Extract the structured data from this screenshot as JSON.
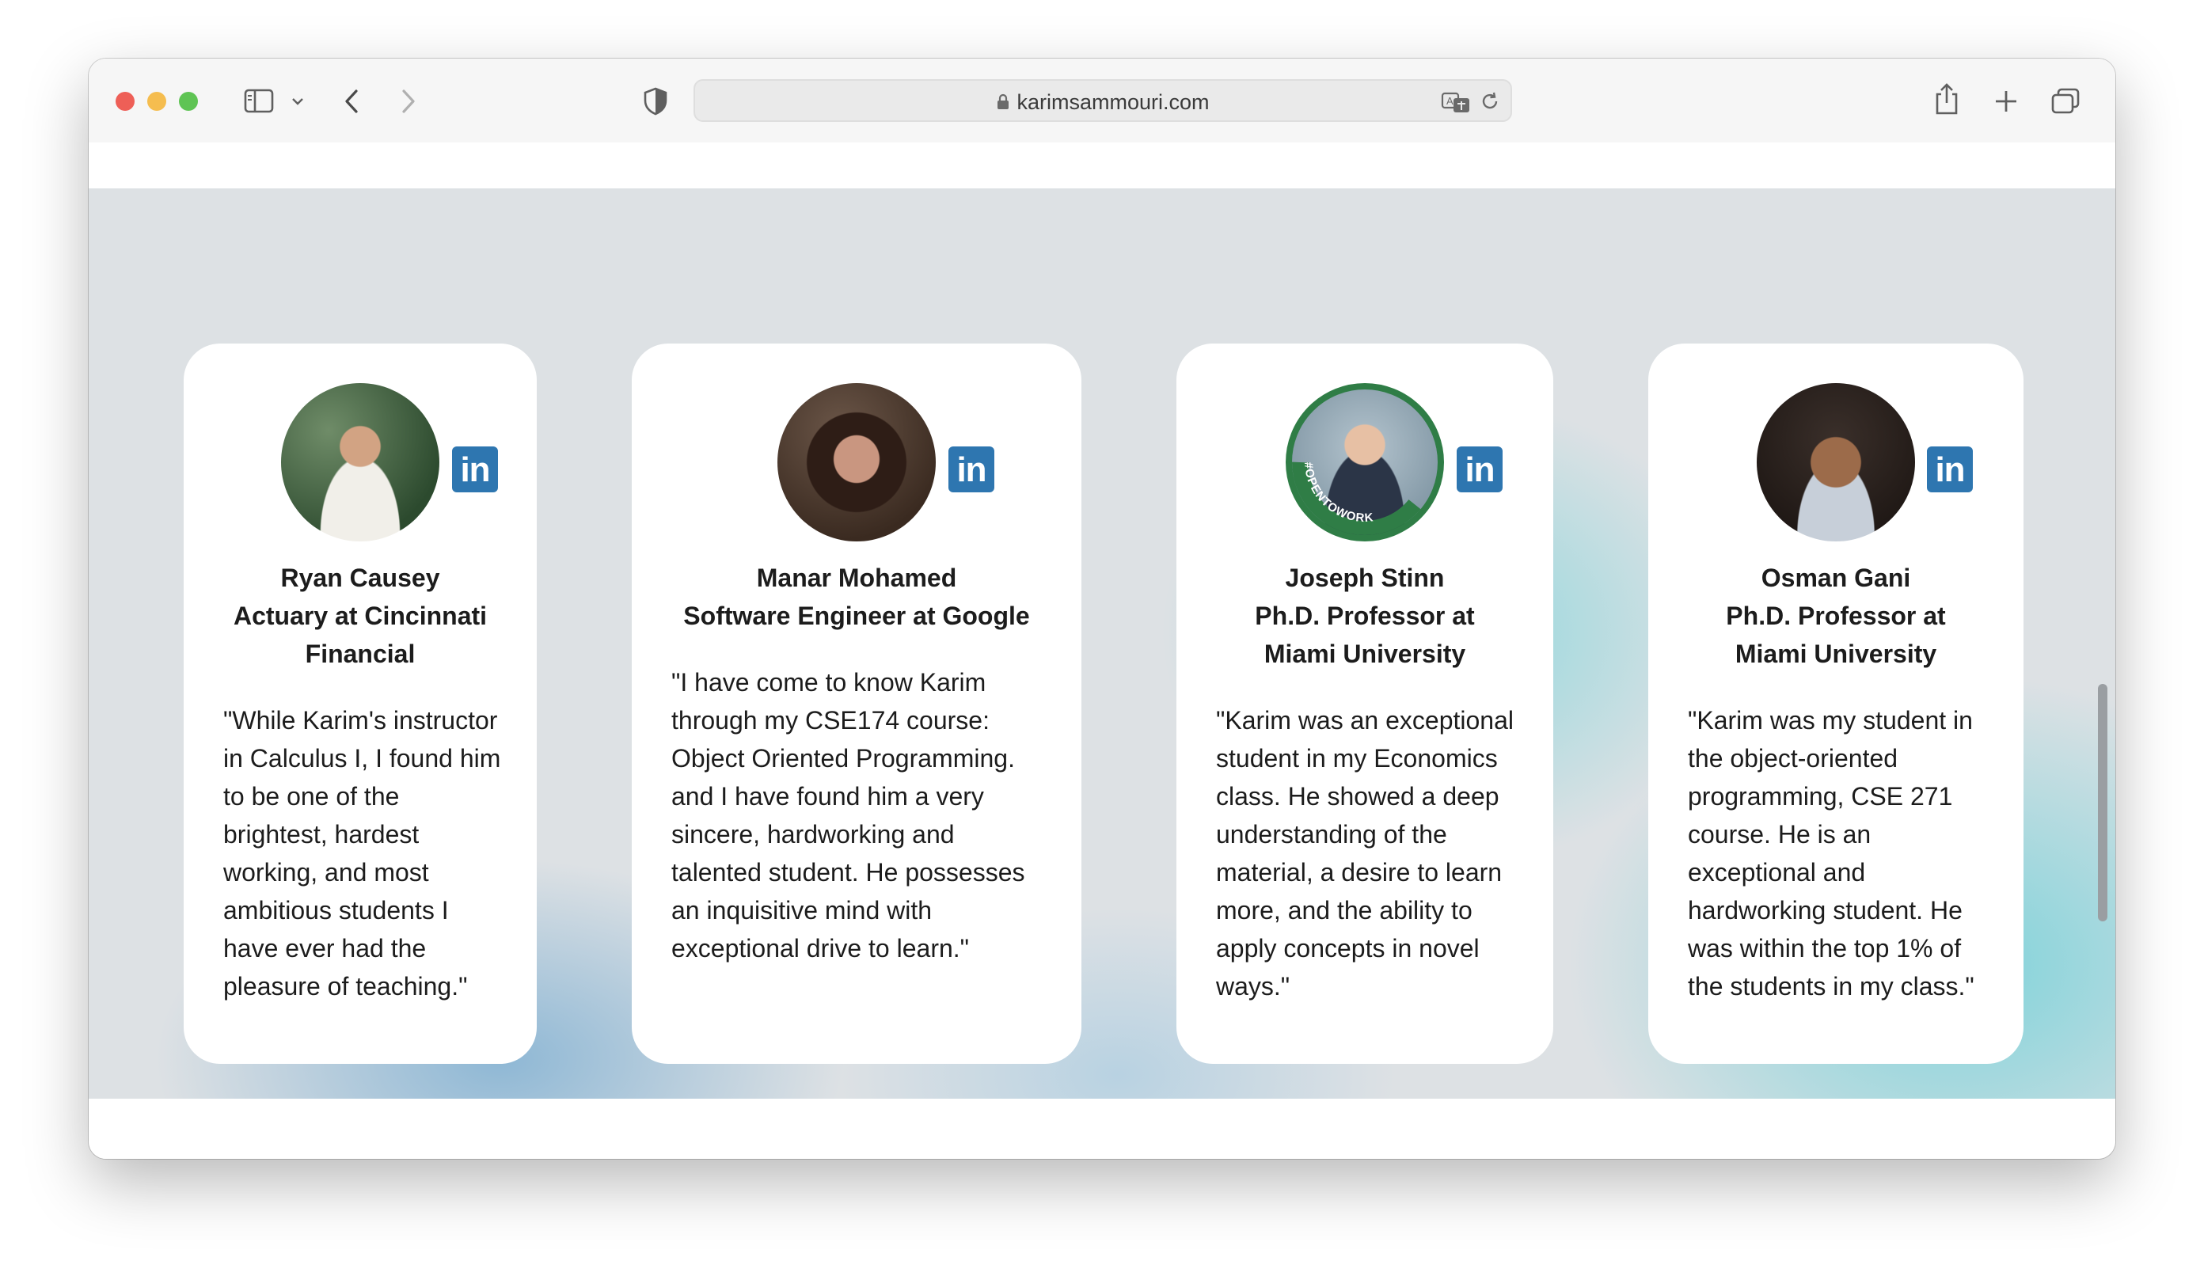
{
  "browser": {
    "url": "karimsammouri.com"
  },
  "testimonials": [
    {
      "name": "Ryan Causey",
      "title": "Actuary at Cincinnati Financial",
      "quote": "\"While Karim's instructor in Calculus I, I found him to be one of the brightest, hardest working, and most ambitious students I have ever had the pleasure of teaching.\"",
      "badge": ""
    },
    {
      "name": "Manar Mohamed",
      "title": "Software Engineer at Google",
      "quote": "\"I have come to know Karim through my CSE174 course: Object Oriented Programming. and I have found him a very sincere, hardworking and talented student. He possesses an inquisitive mind with exceptional drive to learn.\"",
      "badge": ""
    },
    {
      "name": "Joseph Stinn",
      "title": "Ph.D. Professor at Miami University",
      "quote": "\"Karim was an exceptional student in my Economics class. He showed a deep understanding of the material, a desire to learn more, and the ability to apply concepts in novel ways.\"",
      "badge": "#OPENTOWORK"
    },
    {
      "name": "Osman Gani",
      "title": "Ph.D. Professor at Miami University",
      "quote": "\"Karim was my student in the object-oriented programming, CSE 271 course. He is an exceptional and hardworking student. He was within the top 1% of the students in my class.\"",
      "badge": ""
    }
  ],
  "linkedin_label": "in",
  "colors": {
    "linkedin": "#2e76b0",
    "close": "#ee5f57",
    "minimize": "#f5bd4f",
    "zoom": "#5fc454"
  },
  "icons": [
    "sidebar-icon",
    "chevron-down-icon",
    "back-arrow-icon",
    "forward-arrow-icon",
    "shield-icon",
    "lock-icon",
    "translate-icon",
    "reload-icon",
    "share-icon",
    "plus-icon",
    "tabs-overview-icon",
    "linkedin-icon"
  ]
}
